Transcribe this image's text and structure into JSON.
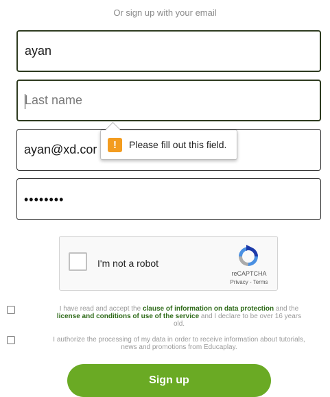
{
  "header": {
    "text": "Or sign up with your email"
  },
  "form": {
    "first_name_value": "ayan",
    "last_name_placeholder": "Last name",
    "email_value": "ayan@xd.cor",
    "password_value": "••••••••"
  },
  "tooltip": {
    "message": "Please fill out this field.",
    "icon": "warning-icon",
    "icon_glyph": "!"
  },
  "captcha": {
    "label": "I'm not a robot",
    "brand": "reCAPTCHA",
    "links": "Privacy - Terms"
  },
  "consent": {
    "line1_a": "I have read and accept the ",
    "line1_b": "clause of information on data protection",
    "line1_c": " and the",
    "line2_a": "license and conditions of use of the service",
    "line2_b": " and I declare to be over 16 years",
    "line3": "old.",
    "marketing_1": "I authorize the processing of my data in order to receive information about tutorials,",
    "marketing_2": "news and promotions from Educaplay."
  },
  "signup": {
    "label": "Sign up"
  },
  "colors": {
    "accent": "#6aaa24",
    "link_green": "#2f6b1a",
    "warning": "#f39c1f"
  }
}
